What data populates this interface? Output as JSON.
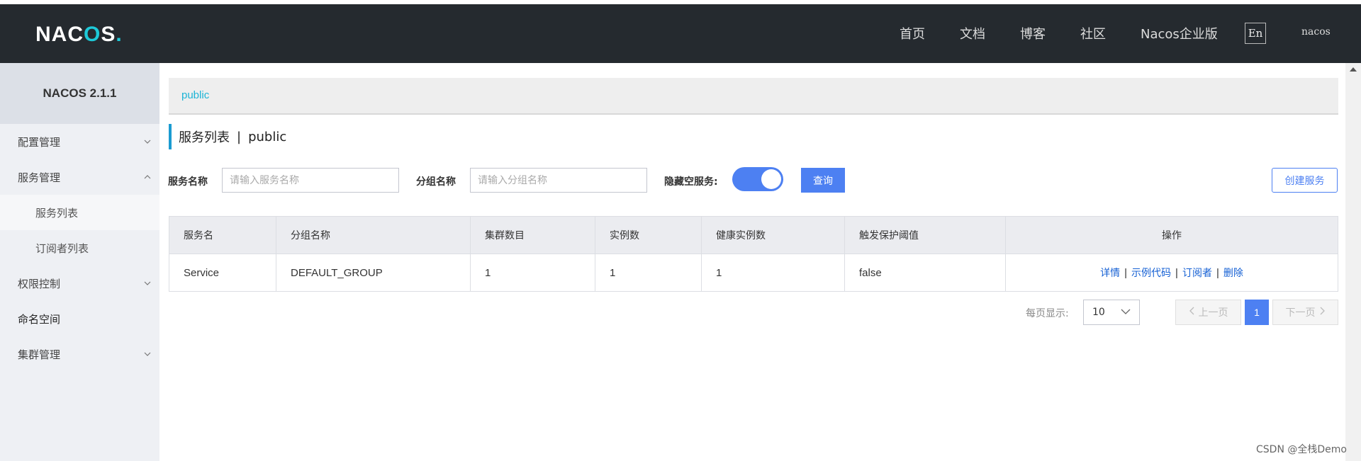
{
  "header": {
    "logo": "NACOS",
    "nav": [
      "首页",
      "文档",
      "博客",
      "社区",
      "Nacos企业版"
    ],
    "lang": "En",
    "user": "nacos"
  },
  "sidebar": {
    "version": "NACOS 2.1.1",
    "items": [
      {
        "label": "配置管理",
        "chevron": "down"
      },
      {
        "label": "服务管理",
        "chevron": "up"
      },
      {
        "label": "服务列表",
        "sub": true,
        "active": true
      },
      {
        "label": "订阅者列表",
        "sub": true
      },
      {
        "label": "权限控制",
        "chevron": "down"
      },
      {
        "label": "命名空间"
      },
      {
        "label": "集群管理",
        "chevron": "down"
      }
    ]
  },
  "breadcrumb": "public",
  "page": {
    "title": "服务列表",
    "sep": "|",
    "namespace": "public"
  },
  "filters": {
    "service_label": "服务名称",
    "service_placeholder": "请输入服务名称",
    "group_label": "分组名称",
    "group_placeholder": "请输入分组名称",
    "hide_empty_label": "隐藏空服务:",
    "query_button": "查询",
    "create_button": "创建服务"
  },
  "table": {
    "headers": [
      "服务名",
      "分组名称",
      "集群数目",
      "实例数",
      "健康实例数",
      "触发保护阈值",
      "操作"
    ],
    "rows": [
      {
        "name": "Service",
        "group": "DEFAULT_GROUP",
        "clusters": "1",
        "instances": "1",
        "healthy": "1",
        "protect": "false"
      }
    ],
    "ops": [
      "详情",
      "示例代码",
      "订阅者",
      "删除"
    ]
  },
  "pagination": {
    "per_page_label": "每页显示:",
    "per_page_value": "10",
    "prev": "上一页",
    "next": "下一页",
    "current": "1"
  },
  "watermark": "CSDN @全栈Demo"
}
